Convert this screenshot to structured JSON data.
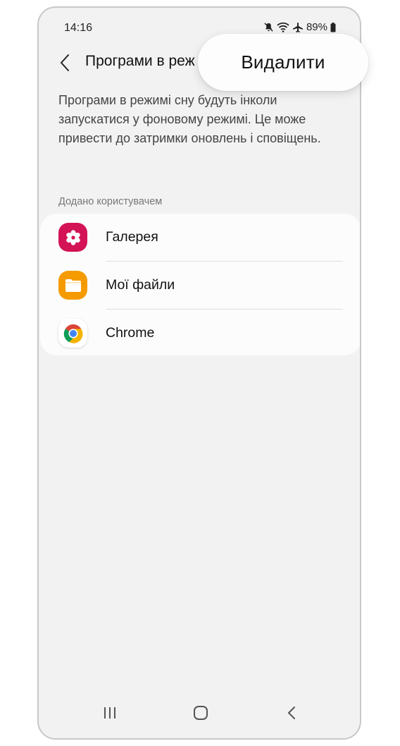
{
  "status_bar": {
    "time": "14:16",
    "battery": "89%",
    "icons": [
      "mute-icon",
      "wifi-icon",
      "airplane-icon",
      "battery-icon"
    ]
  },
  "app_bar": {
    "title": "Програми в реж"
  },
  "description": "Програми в режимі сну будуть інколи запускатися у фоновому режимі. Це може привести до затримки оновлень і сповіщень.",
  "section": {
    "header": "Додано користувачем",
    "apps": [
      {
        "label": "Галерея",
        "icon": "gallery-icon",
        "color": "#d31356"
      },
      {
        "label": "Мої файли",
        "icon": "folder-icon",
        "color": "#f59b00"
      },
      {
        "label": "Chrome",
        "icon": "chrome-icon",
        "color": "#ffffff"
      }
    ]
  },
  "popup_menu": {
    "item": "Видалити"
  },
  "nav_bar": {
    "icons": [
      "recents-icon",
      "home-icon",
      "back-icon"
    ]
  }
}
